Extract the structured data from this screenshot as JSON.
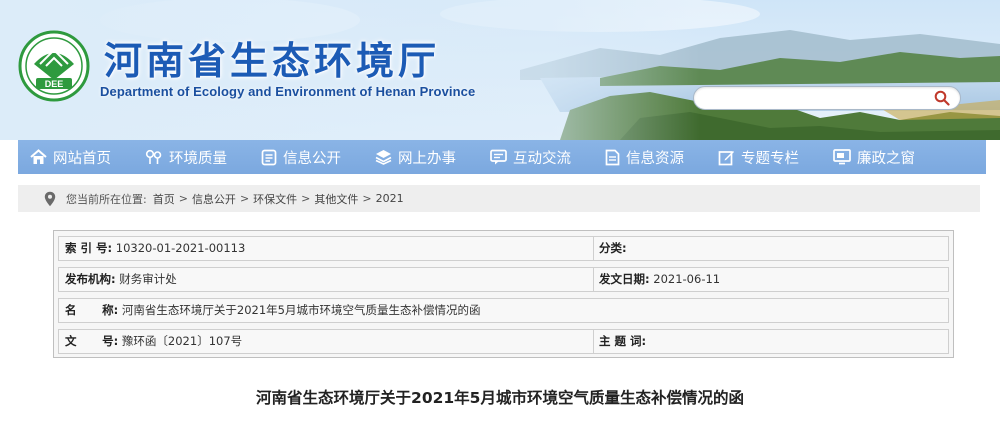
{
  "header": {
    "title": "河南省生态环境厅",
    "subtitle": "Department of Ecology and Environment of Henan Province",
    "logo_text": "DEE",
    "search_placeholder": ""
  },
  "nav": {
    "items": [
      {
        "label": "网站首页",
        "icon": "home-icon"
      },
      {
        "label": "环境质量",
        "icon": "tree-icon"
      },
      {
        "label": "信息公开",
        "icon": "document-icon"
      },
      {
        "label": "网上办事",
        "icon": "layers-icon"
      },
      {
        "label": "互动交流",
        "icon": "chat-icon"
      },
      {
        "label": "信息资源",
        "icon": "file-icon"
      },
      {
        "label": "专题专栏",
        "icon": "edit-icon"
      },
      {
        "label": "廉政之窗",
        "icon": "monitor-icon"
      }
    ]
  },
  "breadcrumb": {
    "prefix": "您当前所在位置:",
    "items": [
      "首页",
      "信息公开",
      "环保文件",
      "其他文件",
      "2021"
    ],
    "separator": ">"
  },
  "info": {
    "index_label": "索 引 号:",
    "index_value": "10320-01-2021-00113",
    "category_label": "分类:",
    "category_value": "",
    "issuer_label": "发布机构:",
    "issuer_value": "财务审计处",
    "date_label": "发文日期:",
    "date_value": "2021-06-11",
    "name_label_1": "名",
    "name_label_2": "称:",
    "name_value": "河南省生态环境厅关于2021年5月城市环境空气质量生态补偿情况的函",
    "docno_label_1": "文",
    "docno_label_2": "号:",
    "docno_value": "豫环函〔2021〕107号",
    "subject_label": "主 题 词:",
    "subject_value": ""
  },
  "document": {
    "title": "河南省生态环境厅关于2021年5月城市环境空气质量生态补偿情况的函"
  },
  "colors": {
    "title_blue": "#1c5bb5",
    "nav_blue": "#7ba8df",
    "logo_green": "#2e9a3e"
  }
}
